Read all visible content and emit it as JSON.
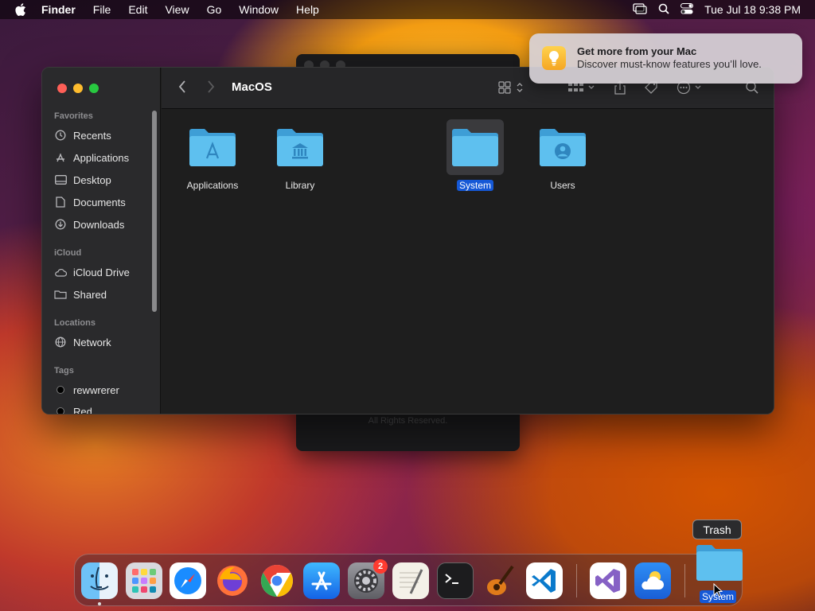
{
  "menubar": {
    "app_name": "Finder",
    "menus": [
      "File",
      "Edit",
      "View",
      "Go",
      "Window",
      "Help"
    ],
    "clock": "Tue Jul 18  9:38 PM"
  },
  "ghost_window": {
    "footer": "All Rights Reserved."
  },
  "notification": {
    "title": "Get more from your Mac",
    "body": "Discover must-know features you’ll love."
  },
  "finder": {
    "title": "MacOS",
    "sidebar": {
      "favorites_header": "Favorites",
      "favorites": [
        {
          "label": "Recents",
          "icon": "clock-icon"
        },
        {
          "label": "Applications",
          "icon": "applications-icon"
        },
        {
          "label": "Desktop",
          "icon": "desktop-icon"
        },
        {
          "label": "Documents",
          "icon": "document-icon"
        },
        {
          "label": "Downloads",
          "icon": "download-icon"
        }
      ],
      "icloud_header": "iCloud",
      "icloud": [
        {
          "label": "iCloud Drive",
          "icon": "cloud-icon"
        },
        {
          "label": "Shared",
          "icon": "shared-folder-icon"
        }
      ],
      "locations_header": "Locations",
      "locations": [
        {
          "label": "Network",
          "icon": "globe-icon"
        }
      ],
      "tags_header": "Tags",
      "tags": [
        {
          "label": "rewwrerer",
          "color": "#000000"
        },
        {
          "label": "Red",
          "color": "#000000"
        }
      ]
    },
    "items": [
      {
        "label": "Applications",
        "icon": "applications-folder-icon",
        "selected": false
      },
      {
        "label": "Library",
        "icon": "library-folder-icon",
        "selected": false
      },
      {
        "label": "System",
        "icon": "folder-icon",
        "selected": true
      },
      {
        "label": "Users",
        "icon": "users-folder-icon",
        "selected": false
      }
    ]
  },
  "dock": {
    "apps": [
      "Finder",
      "Launchpad",
      "Safari",
      "Firefox",
      "Chrome",
      "App Store",
      "System Settings",
      "TextEdit",
      "Terminal",
      "GarageBand",
      "Visual Studio Code",
      "Visual Studio",
      "Weather"
    ],
    "system_settings_badge": "2",
    "tooltip": "Trash",
    "dragged_item_label": "System"
  },
  "colors": {
    "accent": "#1558d6",
    "folder": "#4fb3e8"
  }
}
